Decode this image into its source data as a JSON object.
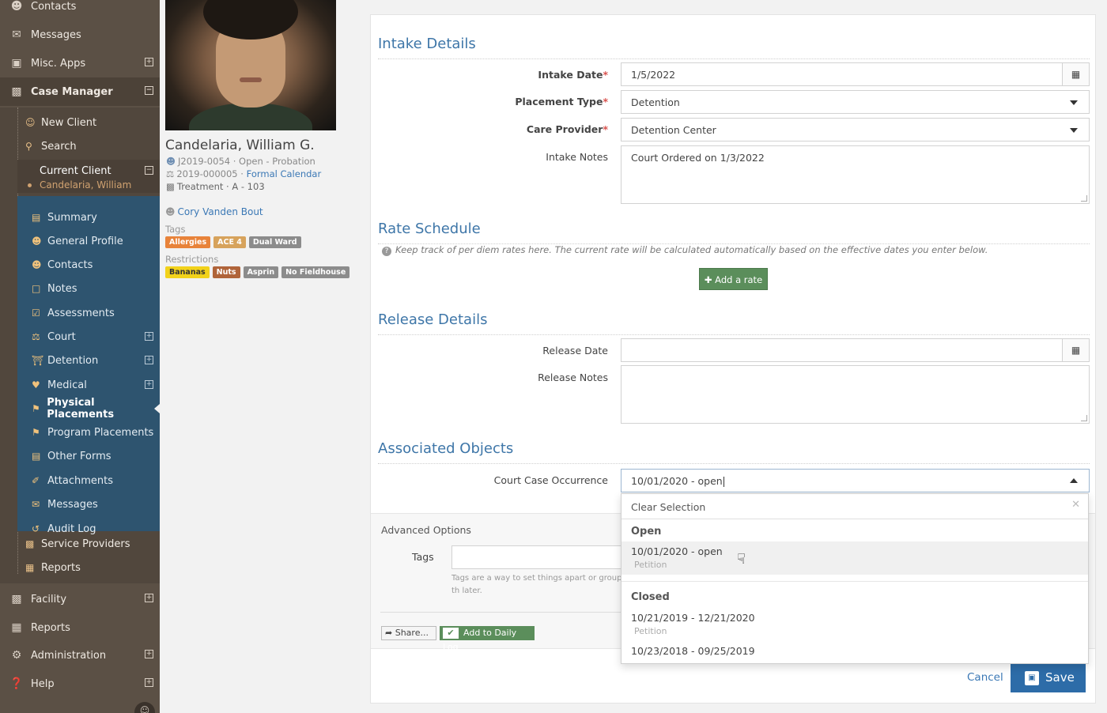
{
  "sidebar": {
    "top_items": [
      {
        "label": "Contacts",
        "icon": "users-icon"
      },
      {
        "label": "Messages",
        "icon": "comments-icon"
      },
      {
        "label": "Misc. Apps",
        "icon": "cubes-icon"
      },
      {
        "label": "Case Manager",
        "icon": "briefcase-icon"
      }
    ],
    "case_manager_items": [
      {
        "label": "New Client",
        "icon": "user-plus-icon"
      },
      {
        "label": "Search",
        "icon": "search-icon"
      }
    ],
    "current_client": {
      "label": "Current Client",
      "name": "Candelaria, William"
    },
    "client_items": [
      {
        "label": "Summary",
        "icon": "list-icon"
      },
      {
        "label": "General Profile",
        "icon": "user-icon"
      },
      {
        "label": "Contacts",
        "icon": "users-icon"
      },
      {
        "label": "Notes",
        "icon": "note-icon"
      },
      {
        "label": "Assessments",
        "icon": "check-square-icon"
      },
      {
        "label": "Court",
        "icon": "scales-icon"
      },
      {
        "label": "Detention",
        "icon": "building-icon"
      },
      {
        "label": "Medical",
        "icon": "heart-icon"
      },
      {
        "label": "Physical Placements",
        "icon": "flag-icon"
      },
      {
        "label": "Program Placements",
        "icon": "flag-icon"
      },
      {
        "label": "Other Forms",
        "icon": "list-icon"
      },
      {
        "label": "Attachments",
        "icon": "paperclip-icon"
      },
      {
        "label": "Messages",
        "icon": "comments-icon"
      },
      {
        "label": "Audit Log",
        "icon": "history-icon"
      }
    ],
    "case_manager_tail": [
      {
        "label": "Service Providers",
        "icon": "building-icon"
      },
      {
        "label": "Reports",
        "icon": "table-icon"
      }
    ],
    "bottom_items": [
      {
        "label": "Facility",
        "icon": "building-icon"
      },
      {
        "label": "Reports",
        "icon": "table-icon"
      },
      {
        "label": "Administration",
        "icon": "gears-icon"
      },
      {
        "label": "Help",
        "icon": "question-icon"
      }
    ]
  },
  "client": {
    "name": "Candelaria, William G.",
    "case_line": "J2019-0054 · Open - Probation",
    "court_case": "2019-000005 · ",
    "court_link": "Formal Calendar",
    "treatment": "Treatment · A - 103",
    "worker": "Cory Vanden Bout",
    "tags_label": "Tags",
    "tags": [
      {
        "label": "Allergies",
        "color": "#e8833a"
      },
      {
        "label": "ACE 4",
        "color": "#d7a35c"
      },
      {
        "label": "Dual Ward",
        "color": "#8c8c8c"
      }
    ],
    "restrictions_label": "Restrictions",
    "restrictions": [
      {
        "label": "Bananas",
        "color": "#f2d21b",
        "text": "#333"
      },
      {
        "label": "Nuts",
        "color": "#b0643a",
        "text": "#fff"
      },
      {
        "label": "Asprin",
        "color": "#8c8c8c",
        "text": "#fff"
      },
      {
        "label": "No Fieldhouse",
        "color": "#8c8c8c",
        "text": "#fff"
      }
    ]
  },
  "form": {
    "intake": {
      "title": "Intake Details",
      "intake_date_label": "Intake Date",
      "intake_date": "1/5/2022",
      "placement_type_label": "Placement Type",
      "placement_type": "Detention",
      "care_provider_label": "Care Provider",
      "care_provider": "Detention Center",
      "intake_notes_label": "Intake Notes",
      "intake_notes": "Court Ordered on 1/3/2022"
    },
    "rate": {
      "title": "Rate Schedule",
      "help": "Keep track of per diem rates here. The current rate will be calculated automatically based on the effective dates you enter below.",
      "add_button": "Add a rate"
    },
    "release": {
      "title": "Release Details",
      "release_date_label": "Release Date",
      "release_date": "",
      "release_notes_label": "Release Notes",
      "release_notes": ""
    },
    "associated": {
      "title": "Associated Objects",
      "court_case_label": "Court Case Occurrence",
      "court_case_value": "10/01/2020 - open"
    },
    "advanced": {
      "title": "Advanced Options",
      "tags_label": "Tags",
      "tags_help": "Tags are a way to set things apart or group th later.",
      "share_label": "Share...",
      "daily_log_label": "Add to Daily Log"
    },
    "cancel_label": "Cancel",
    "save_label": "Save"
  },
  "dropdown": {
    "clear_label": "Clear Selection",
    "groups": [
      {
        "label": "Open",
        "options": [
          {
            "label": "10/01/2020 - open",
            "sub": "Petition"
          }
        ]
      },
      {
        "label": "Closed",
        "options": [
          {
            "label": "10/21/2019 - 12/21/2020",
            "sub": "Petition"
          },
          {
            "label": "10/23/2018 - 09/25/2019",
            "sub": ""
          }
        ]
      }
    ]
  }
}
